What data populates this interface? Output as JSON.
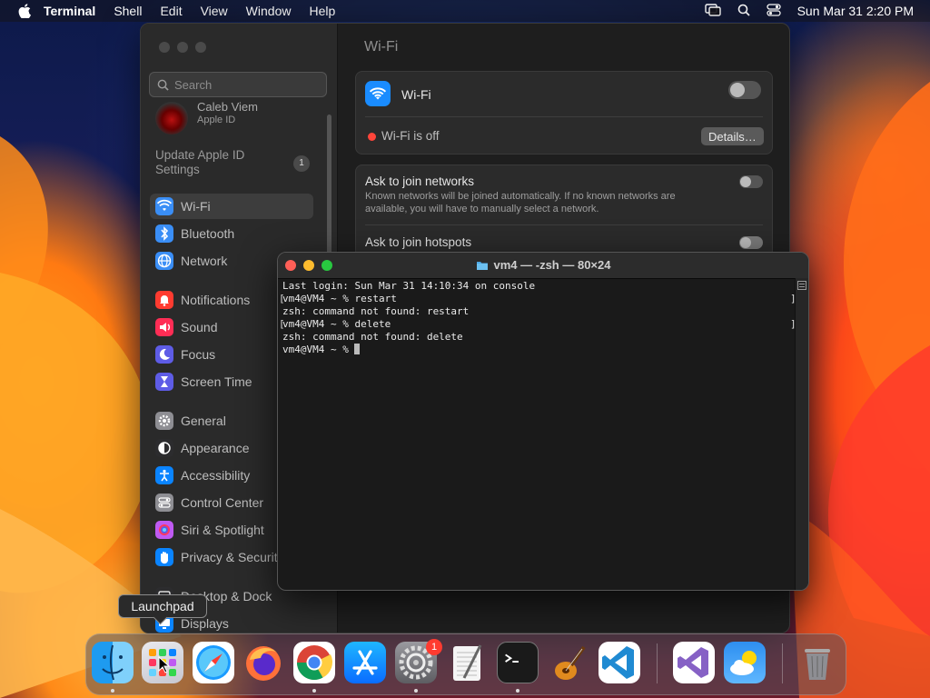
{
  "menubar": {
    "app": "Terminal",
    "items": [
      "Shell",
      "Edit",
      "View",
      "Window",
      "Help"
    ],
    "clock": "Sun Mar 31  2:20 PM"
  },
  "settings": {
    "search_placeholder": "Search",
    "profile": {
      "name": "Caleb Viem",
      "subtitle": "Apple ID"
    },
    "update": {
      "label_line1": "Update Apple ID",
      "label_line2": "Settings",
      "badge": "1"
    },
    "sidebar_items": [
      {
        "label": "Wi-Fi",
        "icon": "wifi-icon",
        "color": "#3a8ef6"
      },
      {
        "label": "Bluetooth",
        "icon": "bluetooth-icon",
        "color": "#3a8ef6"
      },
      {
        "label": "Network",
        "icon": "globe-icon",
        "color": "#3a8ef6"
      },
      {
        "label": "Notifications",
        "icon": "bell-icon",
        "color": "#ff3b30"
      },
      {
        "label": "Sound",
        "icon": "speaker-icon",
        "color": "#ff2d55"
      },
      {
        "label": "Focus",
        "icon": "moon-icon",
        "color": "#5e5ce6"
      },
      {
        "label": "Screen Time",
        "icon": "hourglass-icon",
        "color": "#5e5ce6"
      },
      {
        "label": "General",
        "icon": "gear-icon",
        "color": "#8e8e93"
      },
      {
        "label": "Appearance",
        "icon": "appearance-icon",
        "color": "#2c2c2e"
      },
      {
        "label": "Accessibility",
        "icon": "accessibility-icon",
        "color": "#0a84ff"
      },
      {
        "label": "Control Center",
        "icon": "control-center-icon",
        "color": "#8e8e93"
      },
      {
        "label": "Siri & Spotlight",
        "icon": "siri-icon",
        "color": "#bf5af2"
      },
      {
        "label": "Privacy & Security",
        "icon": "hand-icon",
        "color": "#0a84ff"
      },
      {
        "label": "Desktop & Dock",
        "icon": "dock-icon",
        "color": "#2c2c2e"
      },
      {
        "label": "Displays",
        "icon": "display-icon",
        "color": "#0a84ff"
      }
    ],
    "content_title": "Wi-Fi",
    "wifi_card": {
      "label": "Wi-Fi",
      "status": "Wi-Fi is off",
      "details_button": "Details…"
    },
    "ask_networks": {
      "title": "Ask to join networks",
      "desc_line1": "Known networks will be joined automatically. If no known networks are",
      "desc_line2": "available, you will have to manually select a network."
    },
    "ask_hotspots": {
      "title": "Ask to join hotspots"
    }
  },
  "terminal": {
    "title": "vm4 — -zsh — 80×24",
    "lines": [
      "Last login: Sun Mar 31 14:10:34 on console",
      "vm4@VM4 ~ % restart",
      "zsh: command not found: restart",
      "vm4@VM4 ~ % delete",
      "zsh: command not found: delete",
      "vm4@VM4 ~ % "
    ]
  },
  "tooltip": {
    "text": "Launchpad"
  },
  "dock": {
    "apps": [
      {
        "name": "Finder",
        "icon": "finder-icon"
      },
      {
        "name": "Launchpad",
        "icon": "launchpad-icon"
      },
      {
        "name": "Safari",
        "icon": "safari-icon"
      },
      {
        "name": "Firefox",
        "icon": "firefox-icon"
      },
      {
        "name": "Chrome",
        "icon": "chrome-icon"
      },
      {
        "name": "App Store",
        "icon": "app-store-icon"
      },
      {
        "name": "System Settings",
        "icon": "system-settings-icon",
        "badge": "1"
      },
      {
        "name": "TextEdit",
        "icon": "textedit-icon"
      },
      {
        "name": "Terminal",
        "icon": "terminal-icon"
      },
      {
        "name": "GarageBand",
        "icon": "garageband-icon"
      },
      {
        "name": "Visual Studio Code",
        "icon": "vscode-icon"
      },
      {
        "name": "Visual Studio",
        "icon": "visual-studio-icon"
      },
      {
        "name": "Weather",
        "icon": "weather-icon"
      },
      {
        "name": "Trash",
        "icon": "trash-icon"
      }
    ]
  },
  "colors": {
    "traffic_red": "#ff5f57",
    "traffic_yellow": "#febc2e",
    "traffic_green": "#28c840",
    "status_off": "#ff453a",
    "wifi_blue": "#1a8cff"
  }
}
